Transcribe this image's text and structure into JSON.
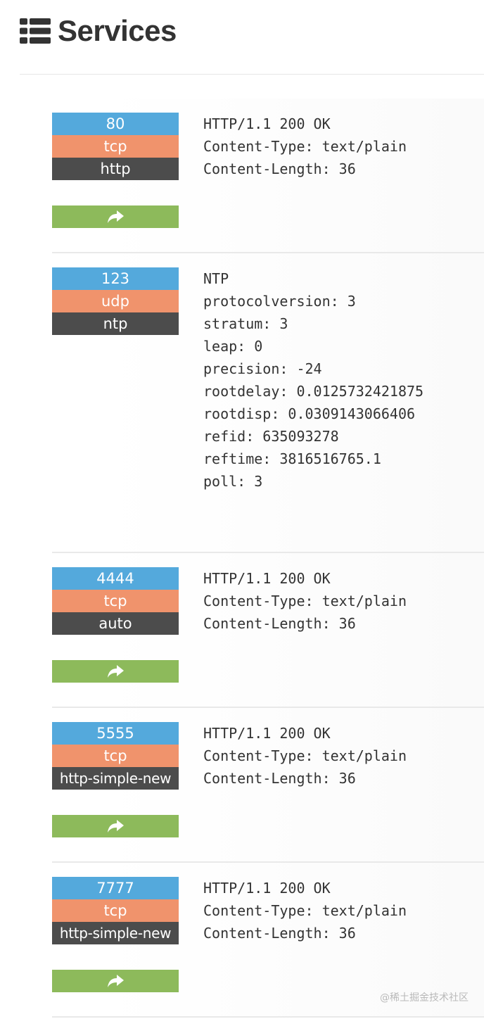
{
  "header": {
    "title": "Services",
    "icon": "list-icon"
  },
  "colors": {
    "port": "#54a9dc",
    "protocol": "#f0936c",
    "name": "#4c4c4c",
    "action": "#8dba5b"
  },
  "services": [
    {
      "port": "80",
      "protocol": "tcp",
      "name": "http",
      "has_link": true,
      "link_icon": "share-icon",
      "banner": [
        "HTTP/1.1 200 OK",
        "Content-Type: text/plain",
        "Content-Length: 36"
      ]
    },
    {
      "port": "123",
      "protocol": "udp",
      "name": "ntp",
      "has_link": false,
      "banner": [
        "NTP",
        "protocolversion: 3",
        "stratum: 3",
        "leap: 0",
        "precision: -24",
        "rootdelay: 0.0125732421875",
        "rootdisp: 0.0309143066406",
        "refid: 635093278",
        "reftime: 3816516765.1",
        "poll: 3"
      ]
    },
    {
      "port": "4444",
      "protocol": "tcp",
      "name": "auto",
      "has_link": true,
      "link_icon": "share-icon",
      "banner": [
        "HTTP/1.1 200 OK",
        "Content-Type: text/plain",
        "Content-Length: 36"
      ]
    },
    {
      "port": "5555",
      "protocol": "tcp",
      "name": "http-simple-new",
      "has_link": true,
      "link_icon": "share-icon",
      "banner": [
        "HTTP/1.1 200 OK",
        "Content-Type: text/plain",
        "Content-Length: 36"
      ]
    },
    {
      "port": "7777",
      "protocol": "tcp",
      "name": "http-simple-new",
      "has_link": true,
      "link_icon": "share-icon",
      "banner": [
        "HTTP/1.1 200 OK",
        "Content-Type: text/plain",
        "Content-Length: 36"
      ]
    }
  ],
  "watermark": "@稀土掘金技术社区"
}
